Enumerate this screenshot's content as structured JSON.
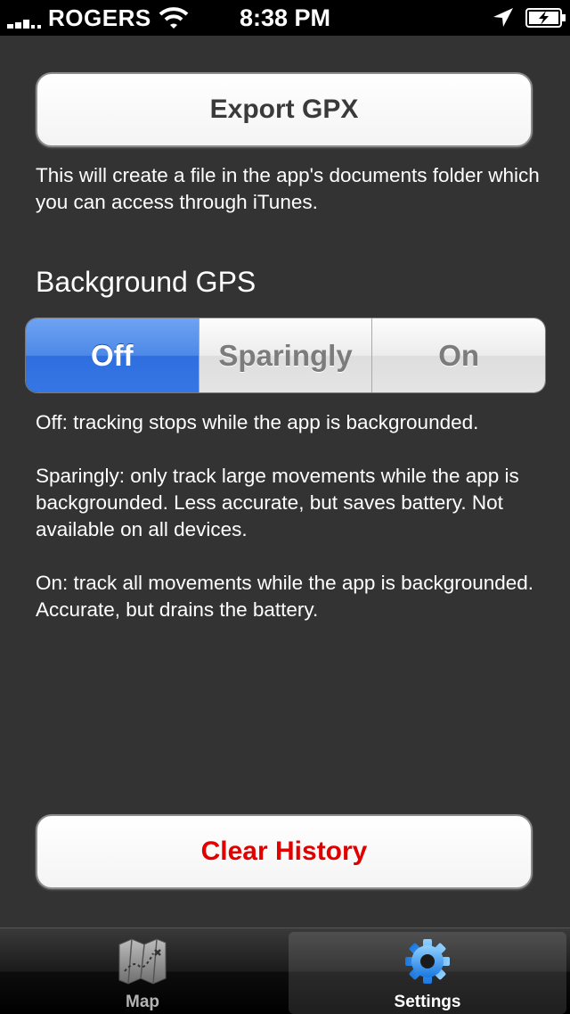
{
  "status_bar": {
    "carrier": "ROGERS",
    "time": "8:38 PM",
    "icons": [
      "signal-icon",
      "wifi-icon",
      "location-arrow-icon",
      "battery-charging-icon"
    ]
  },
  "export": {
    "button_label": "Export GPX",
    "description": "This will create a file in the app's documents folder which you can access through iTunes."
  },
  "background_gps": {
    "title": "Background GPS",
    "options": [
      "Off",
      "Sparingly",
      "On"
    ],
    "selected": "Off",
    "descriptions": [
      "Off: tracking stops while the app is backgrounded.",
      "Sparingly: only track large movements while the app is backgrounded. Less accurate, but saves battery. Not available on all devices.",
      "On: track all movements while the app is backgrounded. Accurate, but drains the battery."
    ]
  },
  "clear_history": {
    "button_label": "Clear History",
    "color": "#e00000"
  },
  "tab_bar": {
    "tabs": [
      {
        "label": "Map",
        "icon": "map-icon"
      },
      {
        "label": "Settings",
        "icon": "gear-icon"
      }
    ],
    "active": "Settings"
  },
  "colors": {
    "background": "#333333",
    "segment_selected": "#3576e4"
  }
}
